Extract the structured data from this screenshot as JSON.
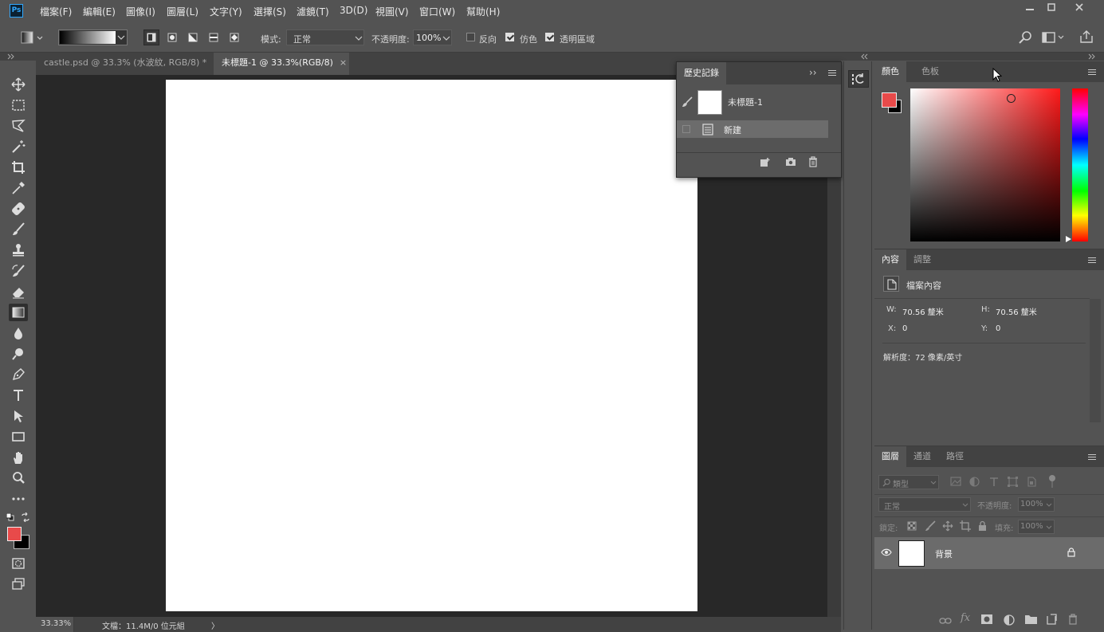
{
  "app": {
    "logo": "Ps"
  },
  "menu": [
    "檔案(F)",
    "編輯(E)",
    "圖像(I)",
    "圖層(L)",
    "文字(Y)",
    "選擇(S)",
    "濾鏡(T)",
    "3D(D)",
    "視圖(V)",
    "窗口(W)",
    "幫助(H)"
  ],
  "options": {
    "mode_label": "模式:",
    "mode_value": "正常",
    "opacity_label": "不透明度:",
    "opacity_value": "100%",
    "reverse_label": "反向",
    "dither_label": "仿色",
    "transparency_label": "透明區域",
    "reverse_checked": false,
    "dither_checked": true,
    "transparency_checked": true
  },
  "tabs": [
    {
      "label": "castle.psd @ 33.3% (水波紋, RGB/8) *",
      "close": "×",
      "active": false
    },
    {
      "label": "未標題-1 @ 33.3%(RGB/8)",
      "close": "×",
      "active": true
    }
  ],
  "status": {
    "zoom": "33.33%",
    "doc_info": "文檔：11.4M/0 位元組",
    "arrow": "〉"
  },
  "history": {
    "tab": "歷史記錄",
    "expand": "››",
    "snapshot_label": "未標題-1",
    "step_label": "新建"
  },
  "color_panel": {
    "tabs": [
      "顏色",
      "色板"
    ],
    "foreground": "#e84a4a",
    "background": "#000000"
  },
  "properties": {
    "tabs": [
      "內容",
      "調整"
    ],
    "doc_label": "檔案內容",
    "w_label": "W:",
    "w_value": "70.56 釐米",
    "h_label": "H:",
    "h_value": "70.56 釐米",
    "x_label": "X:",
    "x_value": "0",
    "y_label": "Y:",
    "y_value": "0",
    "resolution": "解析度：72 像素/英寸"
  },
  "layers": {
    "tabs": [
      "圖層",
      "通道",
      "路徑"
    ],
    "filter_placeholder": "類型",
    "blend_mode": "正常",
    "opacity_label": "不透明度:",
    "opacity_value": "100%",
    "lock_label": "鎖定:",
    "fill_label": "填充:",
    "fill_value": "100%",
    "layer_name": "背景",
    "fx_label": "fx"
  }
}
